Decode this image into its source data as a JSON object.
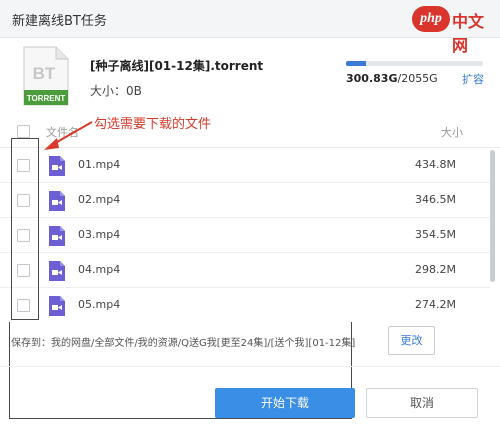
{
  "dialog": {
    "title": "新建离线BT任务"
  },
  "watermark": {
    "php": "php",
    "cn": "中文网"
  },
  "torrent": {
    "icon_text": "BT",
    "icon_label": "TORRENT",
    "name": "[种子离线][01-12集].torrent",
    "size_label": "大小：0B"
  },
  "storage": {
    "used": "300.83G",
    "total": "/2055G",
    "fraction": 0.146,
    "expand_label": "扩容"
  },
  "list": {
    "name_header": "文件名",
    "size_header": "大小",
    "files": [
      {
        "name": "01.mp4",
        "size": "434.8M"
      },
      {
        "name": "02.mp4",
        "size": "346.5M"
      },
      {
        "name": "03.mp4",
        "size": "354.5M"
      },
      {
        "name": "04.mp4",
        "size": "298.2M"
      },
      {
        "name": "05.mp4",
        "size": "274.2M"
      }
    ]
  },
  "annotation": {
    "text": "勾选需要下载的文件"
  },
  "save": {
    "path": "保存到：我的网盘/全部文件/我的资源/Q送G我[更至24集]/[送个我][01-12集]",
    "change_label": "更改"
  },
  "actions": {
    "start_label": "开始下载",
    "cancel_label": "取消"
  },
  "colors": {
    "accent": "#3a8ee6",
    "annotation": "#d83a2b",
    "video_icon": "#6c5fd3",
    "torrent_green": "#4a9d3a"
  },
  "icons": {
    "file_type": "video-file-icon",
    "torrent": "torrent-file-icon"
  }
}
